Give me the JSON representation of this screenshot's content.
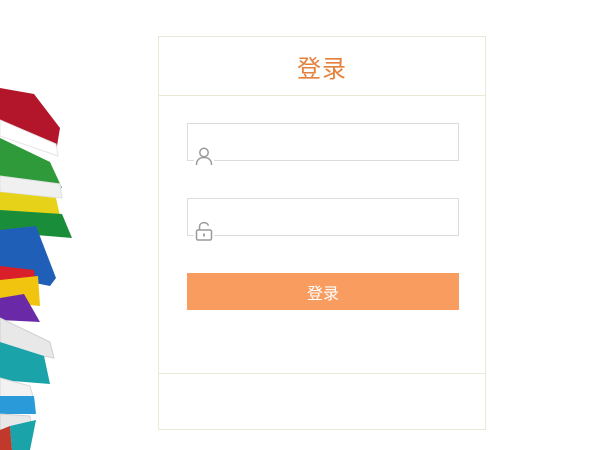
{
  "login": {
    "title": "登录",
    "username": {
      "value": "",
      "placeholder": ""
    },
    "password": {
      "value": "",
      "placeholder": ""
    },
    "submit_label": "登录"
  },
  "icons": {
    "username": "user-icon",
    "password": "lock-icon",
    "decoration": "book-stack-icon"
  },
  "colors": {
    "title": "#e6813c",
    "button": "#f89c60",
    "border": "#ebe8d6"
  }
}
